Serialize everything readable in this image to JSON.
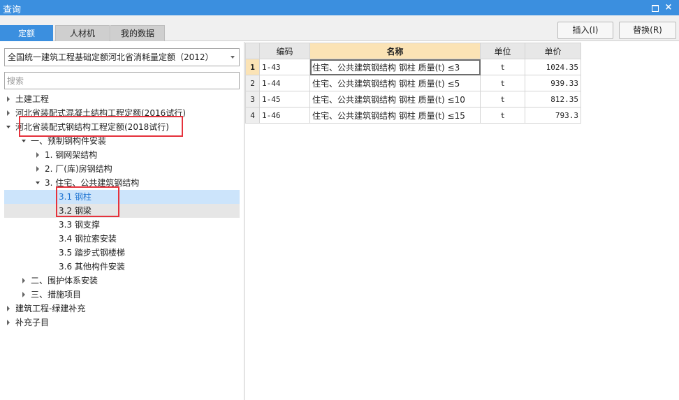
{
  "window": {
    "title": "查询",
    "maximize_symbol": "",
    "close_symbol": "×"
  },
  "tabs": [
    {
      "label": "定额",
      "active": true
    },
    {
      "label": "人材机",
      "active": false
    },
    {
      "label": "我的数据",
      "active": false
    }
  ],
  "toolbar": {
    "insert_label": "插入(I)",
    "replace_label": "替换(R)"
  },
  "left": {
    "dropdown_value": "全国统一建筑工程基础定额河北省消耗量定额（2012）",
    "search_placeholder": "搜索"
  },
  "tree": [
    {
      "label": "土建工程",
      "level": 0,
      "state": "collapsed"
    },
    {
      "label": "河北省装配式混凝土结构工程定额(2016试行)",
      "level": 0,
      "state": "collapsed"
    },
    {
      "label": "河北省装配式钢结构工程定额(2018试行)",
      "level": 0,
      "state": "expanded"
    },
    {
      "label": "一、预制钢构件安装",
      "level": 1,
      "state": "expanded"
    },
    {
      "label": "1. 钢网架结构",
      "level": 2,
      "state": "collapsed"
    },
    {
      "label": "2. 厂(库)房钢结构",
      "level": 2,
      "state": "collapsed"
    },
    {
      "label": "3. 住宅、公共建筑钢结构",
      "level": 2,
      "state": "expanded"
    },
    {
      "label": "3.1 钢柱",
      "level": 3,
      "state": "leaf",
      "selected": true
    },
    {
      "label": "3.2 钢梁",
      "level": 3,
      "state": "leaf",
      "hover": true
    },
    {
      "label": "3.3 钢支撑",
      "level": 3,
      "state": "leaf"
    },
    {
      "label": "3.4 钢拉索安装",
      "level": 3,
      "state": "leaf"
    },
    {
      "label": "3.5 踏步式钢楼梯",
      "level": 3,
      "state": "leaf"
    },
    {
      "label": "3.6 其他构件安装",
      "level": 3,
      "state": "leaf"
    },
    {
      "label": "二、围护体系安装",
      "level": 1,
      "state": "collapsed"
    },
    {
      "label": "三、措施项目",
      "level": 1,
      "state": "collapsed"
    },
    {
      "label": "建筑工程-绿建补充",
      "level": 0,
      "state": "collapsed"
    },
    {
      "label": "补充子目",
      "level": 0,
      "state": "collapsed"
    }
  ],
  "grid": {
    "columns": [
      "编码",
      "名称",
      "单位",
      "单价"
    ],
    "rows": [
      {
        "num": "1",
        "code": "1-43",
        "name": "住宅、公共建筑钢结构 钢柱 质量(t) ≤3",
        "unit": "t",
        "price": "1024.35"
      },
      {
        "num": "2",
        "code": "1-44",
        "name": "住宅、公共建筑钢结构 钢柱 质量(t) ≤5",
        "unit": "t",
        "price": "939.33"
      },
      {
        "num": "3",
        "code": "1-45",
        "name": "住宅、公共建筑钢结构 钢柱 质量(t) ≤10",
        "unit": "t",
        "price": "812.35"
      },
      {
        "num": "4",
        "code": "1-46",
        "name": "住宅、公共建筑钢结构 钢柱 质量(t) ≤15",
        "unit": "t",
        "price": "793.3"
      }
    ]
  },
  "colors": {
    "accent": "#3b8fdf",
    "selection": "#cce4fb",
    "highlight_box": "#e5323c",
    "header_sorted": "#fbe3b5"
  }
}
